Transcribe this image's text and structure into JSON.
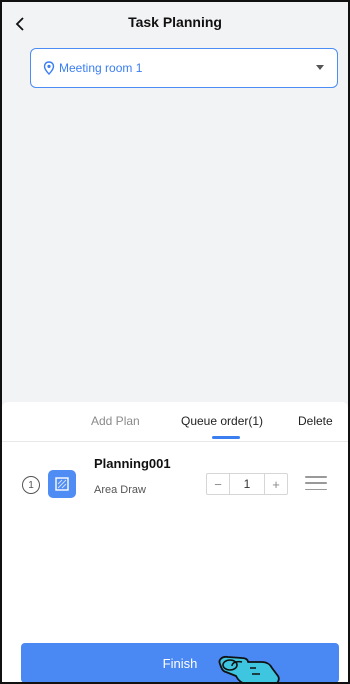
{
  "header": {
    "title": "Task Planning"
  },
  "room_select": {
    "value": "Meeting room 1"
  },
  "tabs": [
    {
      "label": "Add Plan"
    },
    {
      "label": "Queue order(1)"
    },
    {
      "label": "Delete"
    }
  ],
  "plans": [
    {
      "order": "1",
      "name": "Planning001",
      "type": "Area Draw",
      "count": "1",
      "minus": "−",
      "plus": "+"
    }
  ],
  "footer": {
    "finish_label": "Finish"
  },
  "icons": {
    "back": "chevron-left-icon",
    "location": "location-pin-icon",
    "dropdown": "caret-down-icon",
    "area": "area-draw-icon",
    "drag": "drag-handle-icon",
    "pointer": "hand-pointer-icon"
  },
  "colors": {
    "accent": "#3a7ef0",
    "button": "#4a88f3",
    "background": "#f2f3f5"
  }
}
